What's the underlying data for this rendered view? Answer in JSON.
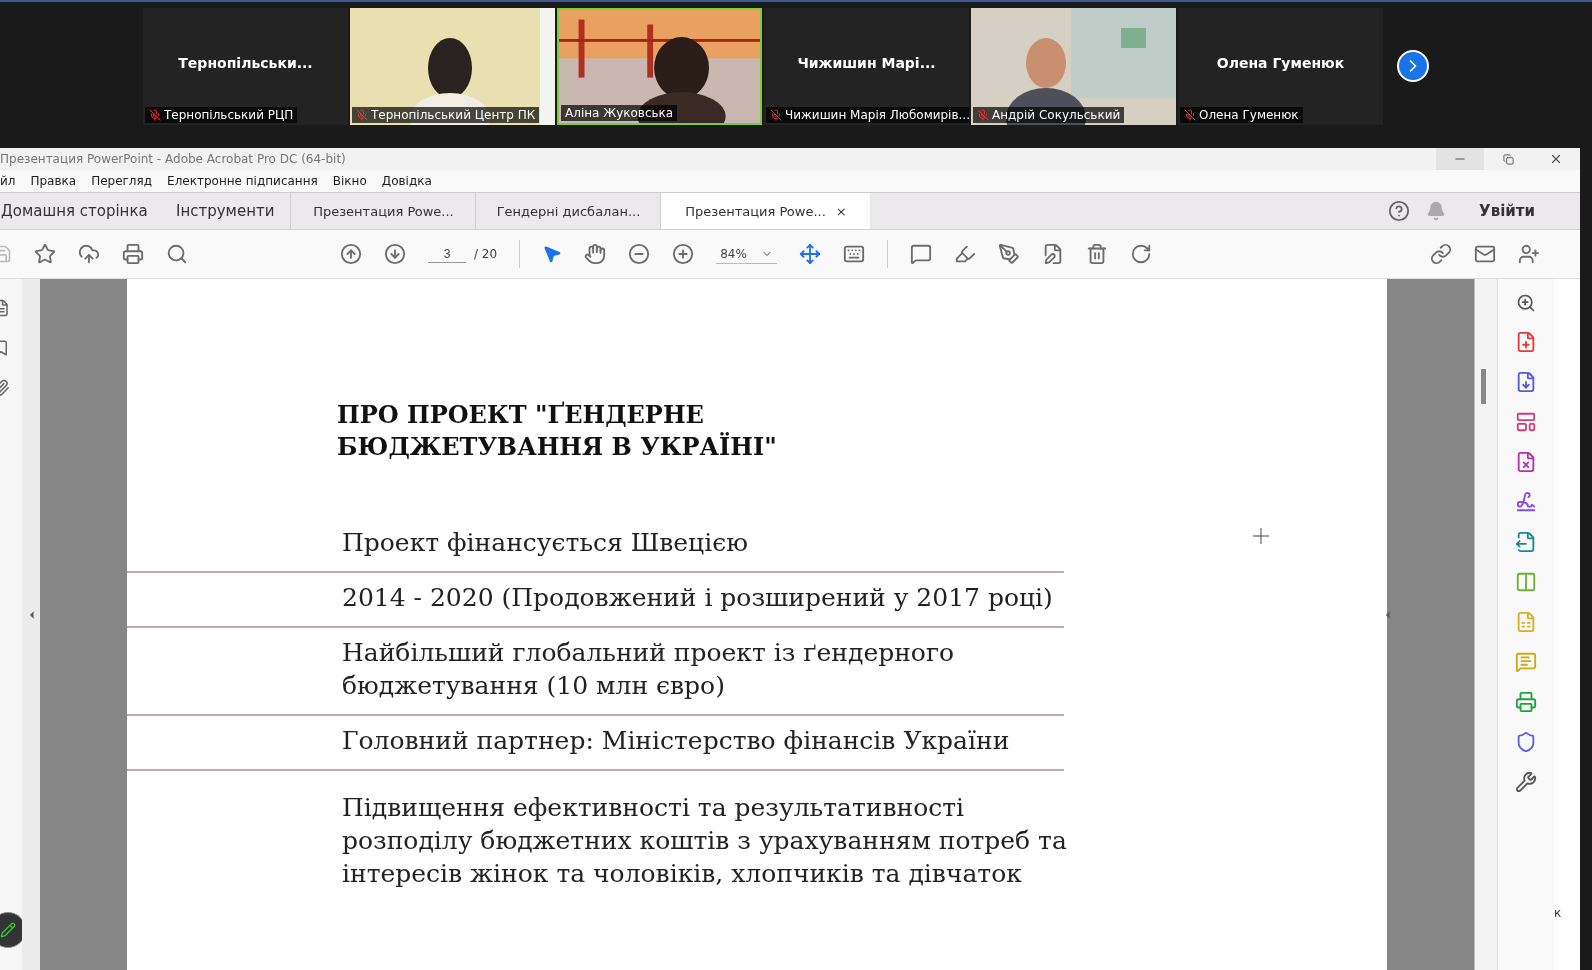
{
  "participants": [
    {
      "kind": "name",
      "display": "Тернопільськи...",
      "label": "Тернопільський РЦП",
      "muted": true,
      "selected": false
    },
    {
      "kind": "video",
      "label": "Тернопільський Центр ПК",
      "muted": true,
      "selected": false
    },
    {
      "kind": "video",
      "label": "Аліна Жуковська",
      "muted": false,
      "selected": true
    },
    {
      "kind": "name",
      "display": "Чижишин  Марі...",
      "label": "Чижишин Марія Любомирів...",
      "muted": true,
      "selected": false
    },
    {
      "kind": "video",
      "label": "Андрій Сокульський",
      "muted": true,
      "selected": false
    },
    {
      "kind": "name",
      "display": "Олена Гуменюк",
      "label": "Олена Гуменюк",
      "muted": true,
      "selected": false
    }
  ],
  "window": {
    "title": "Презентация PowerPoint - Adobe Acrobat Pro DC (64-bit)"
  },
  "menu": [
    "йл",
    "Правка",
    "Перегляд",
    "Електронне підписання",
    "Вікно",
    "Довідка"
  ],
  "nav_tabs": [
    "Домашня сторінка",
    "Інструменти"
  ],
  "doc_tabs": [
    {
      "label": "Презентация Powe...",
      "selected": false
    },
    {
      "label": "Гендерні дисбалан...",
      "selected": false
    },
    {
      "label": "Презентация Powe...",
      "selected": true,
      "close": "×"
    }
  ],
  "sign_in": "Увійти",
  "toolbar": {
    "page": "3",
    "pages": "/ 20",
    "zoom": "84%"
  },
  "slide": {
    "title_lines": [
      "ПРО ПРОЕКТ \"ҐЕНДЕРНЕ",
      "БЮДЖЕТУВАННЯ В УКРАЇНІ\""
    ],
    "rows": [
      {
        "lines": [
          "Проект фінансується Швецією"
        ]
      },
      {
        "lines": [
          "2014 - 2020 (Продовжений і розширений у 2017 році)"
        ]
      },
      {
        "lines": [
          "Найбільший глобальний проект із ґендерного",
          "бюджетування (10 млн євро)"
        ]
      },
      {
        "lines": [
          "Головний партнер: Міністерство фінансів України"
        ]
      },
      {
        "lines": [
          "Підвищення ефективності та результативності",
          "розподілу бюджетних коштів з урахуванням потреб та",
          "інтересів жінок та чоловіків, хлопчиків та дівчаток"
        ]
      }
    ]
  },
  "edge_text": "к"
}
